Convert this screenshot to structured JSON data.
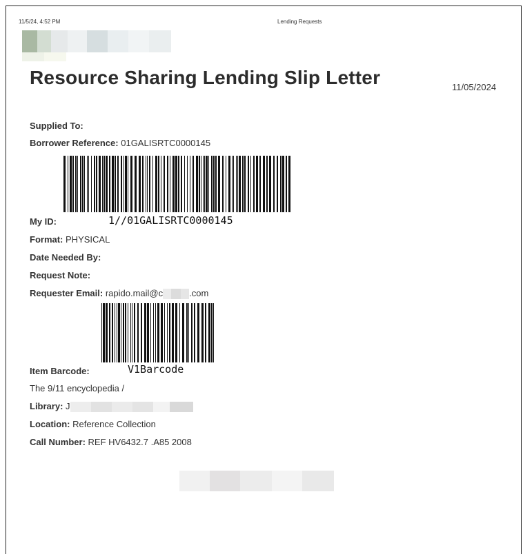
{
  "header": {
    "timestamp": "11/5/24, 4:52 PM",
    "window_title": "Lending Requests"
  },
  "letter": {
    "title": "Resource Sharing Lending Slip Letter",
    "date": "11/05/2024",
    "supplied_to_label": "Supplied To:",
    "borrower_reference_label": "Borrower Reference:",
    "borrower_reference_value": "01GALISRTC0000145",
    "my_id_label": "My ID:",
    "my_id_barcode_text": "1//01GALISRTC0000145",
    "format_label": "Format:",
    "format_value": "PHYSICAL",
    "date_needed_label": "Date Needed By:",
    "request_note_label": "Request Note:",
    "requester_email_label": "Requester Email:",
    "requester_email_prefix": "rapido.mail@c",
    "requester_email_suffix": ".com",
    "item_barcode_label": "Item Barcode:",
    "item_barcode_text": "V1Barcode",
    "item_title": "The 9/11 encyclopedia /",
    "library_label": "Library:",
    "library_value_prefix": "J",
    "location_label": "Location:",
    "location_value": "Reference Collection",
    "call_number_label": "Call Number:",
    "call_number_value": "REF HV6432.7 .A85 2008"
  }
}
